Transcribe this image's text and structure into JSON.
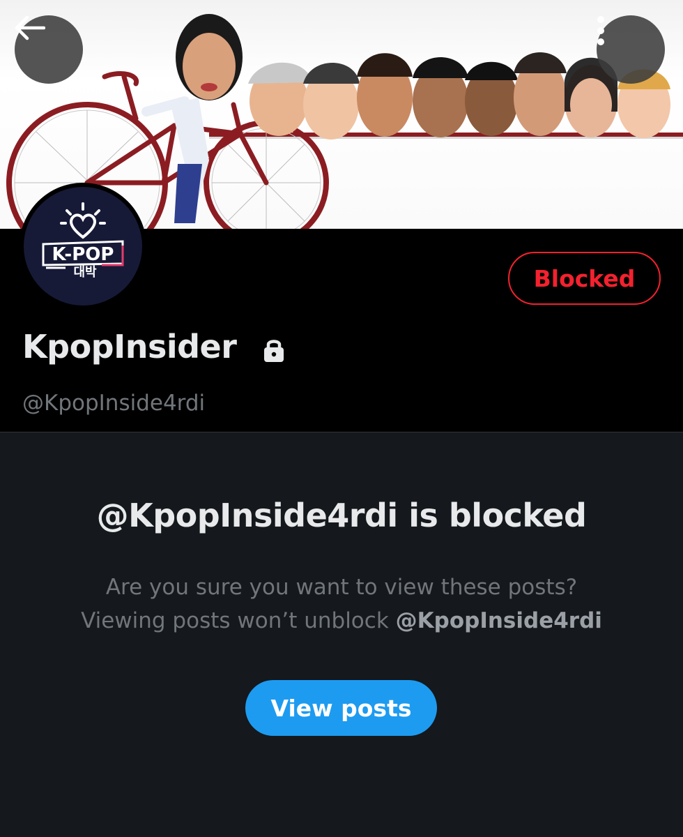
{
  "profile": {
    "display_name": "KpopInsider",
    "handle": "@KpopInside4rdi",
    "relationship_label": "Blocked",
    "avatar_logo": {
      "line1": "K-POP",
      "line2": "대박"
    }
  },
  "blocked_notice": {
    "title": "@KpopInside4rdi is blocked",
    "question": "Are you sure you want to view these posts?",
    "info_prefix": "Viewing posts won’t unblock ",
    "info_handle": "@KpopInside4rdi",
    "button_label": "View posts"
  },
  "icons": {
    "back": "arrow-left-icon",
    "more": "vertical-dots-icon",
    "protected": "lock-icon"
  },
  "colors": {
    "accent": "#1d9bf0",
    "blocked": "#f4212e",
    "background": "#15181c",
    "header_bg": "#000000",
    "text_primary": "#e7e9ea",
    "text_secondary": "#71767b"
  }
}
